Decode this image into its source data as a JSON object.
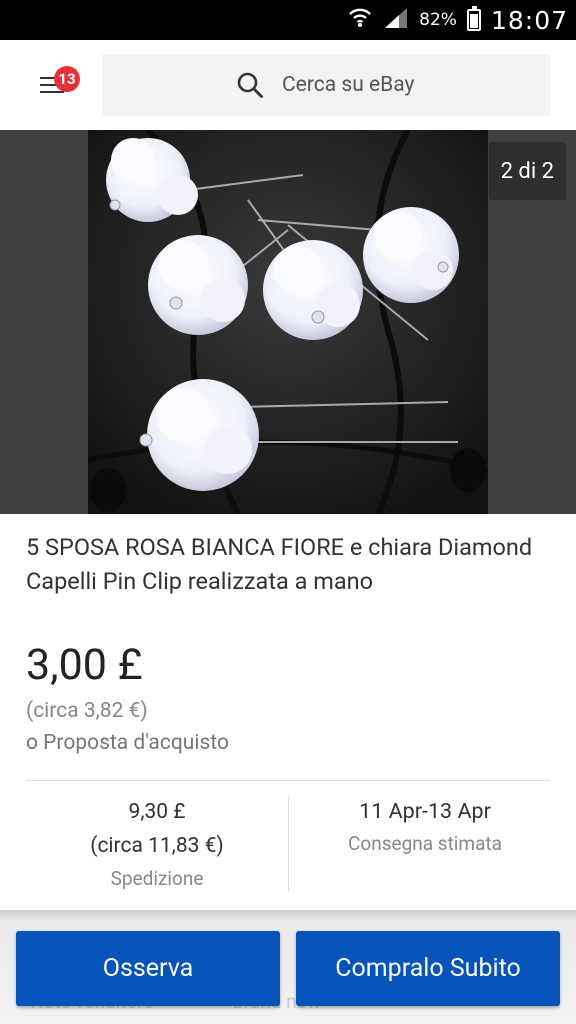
{
  "status_bar": {
    "battery_percent": "82%",
    "time": "18:07"
  },
  "header": {
    "notification_count": "13",
    "search_placeholder": "Cerca su eBay"
  },
  "gallery": {
    "counter": "2 di 2"
  },
  "item": {
    "title": "5 SPOSA ROSA BIANCA FIORE e chiara Diamond Capelli Pin Clip realizzata a mano",
    "price": "3,00 £",
    "price_approx": "(circa 3,82 €)",
    "best_offer": "o Proposta d'acquisto"
  },
  "shipping": {
    "cost": "9,30 £",
    "cost_approx": "(circa 11,83 €)",
    "label": "Spedizione"
  },
  "delivery": {
    "dates": "11 Apr-13 Apr",
    "label": "Consegna stimata"
  },
  "actions": {
    "watch_label": "Osserva",
    "buy_now_label": "Compralo Subito"
  },
  "background_text": {
    "left": "Note venditore",
    "right": "Brand new"
  },
  "colors": {
    "accent": "#0654ba",
    "badge": "#e53238"
  }
}
